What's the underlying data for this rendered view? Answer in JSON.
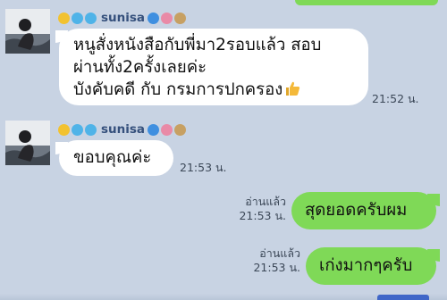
{
  "chat": {
    "messages": [
      {
        "sender": "sunisa",
        "lines": [
          "หนูสั่งหนังสือกับพี่มา2รอบแล้ว สอบ",
          "ผ่านทั้ง2ครั้งเลยค่ะ",
          "บังคับคดี กับ กรมการปกครอง"
        ],
        "emoji": "thumbs-up-icon",
        "time": "21:52 น."
      },
      {
        "sender": "sunisa",
        "lines": [
          "ขอบคุณค่ะ"
        ],
        "time": "21:53 น."
      },
      {
        "read_label": "อ่านแล้ว",
        "time": "21:53 น.",
        "lines": [
          "สุดยอดครับผม"
        ]
      },
      {
        "read_label": "อ่านแล้ว",
        "time": "21:53 น.",
        "lines": [
          "เก่งมากๆครับ"
        ]
      }
    ]
  },
  "colors": {
    "background": "#c8d3e3",
    "incoming_bubble": "#ffffff",
    "outgoing_bubble": "#7fd957",
    "sender_name": "#35507c"
  }
}
